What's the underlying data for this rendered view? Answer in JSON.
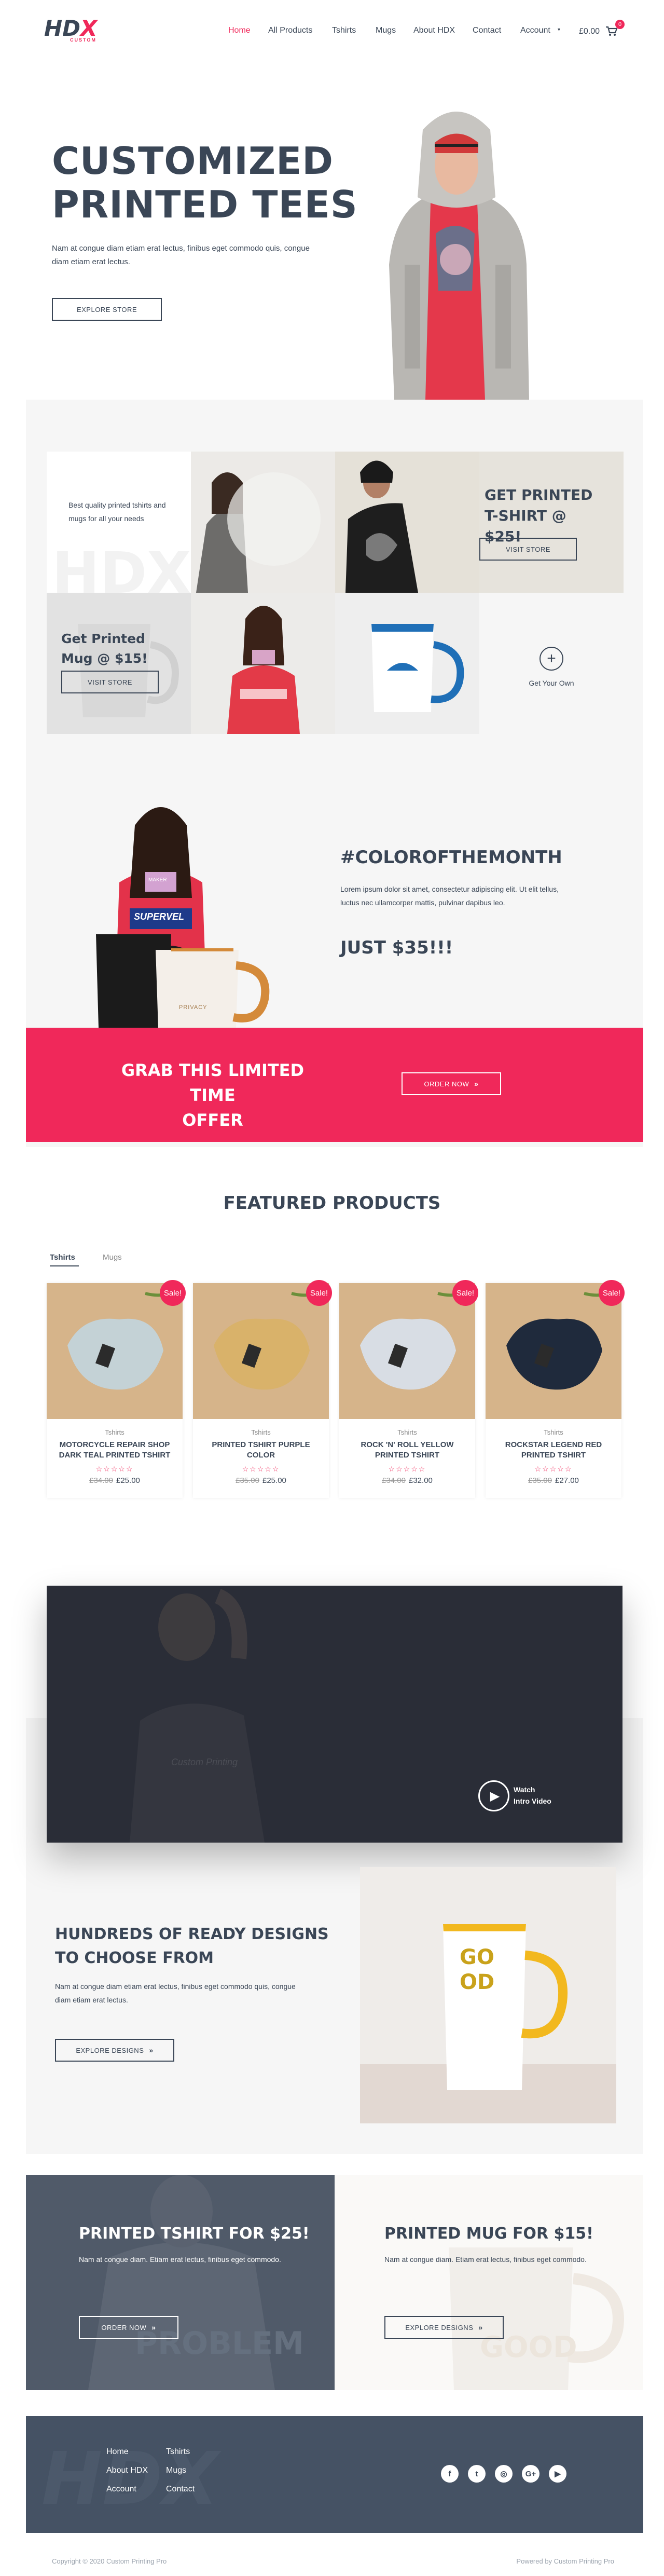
{
  "header": {
    "logo_text": "HDX",
    "logo_sub": "CUSTOM",
    "nav": [
      "Home",
      "All Products",
      "Tshirts",
      "Mugs",
      "About HDX",
      "Contact",
      "Account"
    ],
    "cart_total": "£0.00",
    "cart_count": "0"
  },
  "hero": {
    "title_line1": "CUSTOMIZED",
    "title_line2": "PRINTED TEES",
    "text": "Nam at congue diam etiam erat lectus, finibus eget commodo quis, congue diam etiam erat lectus.",
    "button": "EXPLORE STORE"
  },
  "tiles": {
    "intro_text": "Best quality printed tshirts and mugs for all your needs",
    "tshirt_title": "GET PRINTED T-SHIRT @ $25!",
    "tshirt_button": "VISIT STORE",
    "mug_title": "Get Printed Mug @ $15!",
    "mug_button": "VISIT STORE",
    "own_label": "Get Your Own",
    "watermark": "HDX"
  },
  "color_month": {
    "title": "#COLOROFTHEMONTH",
    "text": "Lorem ipsum dolor sit amet, consectetur adipiscing elit. Ut elit tellus, luctus nec ullamcorper mattis, pulvinar dapibus leo.",
    "price": "JUST $35!!!",
    "tee_print": "SUPERVEL",
    "card_text": "MAKER",
    "mug_text": "PRIVACY"
  },
  "offer": {
    "title_line1": "GRAB THIS LIMITED TIME",
    "title_line2": "OFFER",
    "button": "ORDER NOW"
  },
  "featured": {
    "title": "FEATURED PRODUCTS",
    "tabs": [
      "Tshirts",
      "Mugs"
    ],
    "products": [
      {
        "cat": "Tshirts",
        "title": "MOTORCYCLE REPAIR SHOP DARK TEAL PRINTED TSHIRT",
        "old": "£34.00",
        "price": "£25.00",
        "sale": "Sale!",
        "color": "#c4d2d6"
      },
      {
        "cat": "Tshirts",
        "title": "PRINTED TSHIRT PURPLE COLOR",
        "old": "£35.00",
        "price": "£25.00",
        "sale": "Sale!",
        "color": "#d9b26a"
      },
      {
        "cat": "Tshirts",
        "title": "ROCK 'N' ROLL YELLOW PRINTED TSHIRT",
        "old": "£34.00",
        "price": "£32.00",
        "sale": "Sale!",
        "color": "#d8dde4"
      },
      {
        "cat": "Tshirts",
        "title": "ROCKSTAR LEGEND RED PRINTED TSHIRT",
        "old": "£35.00",
        "price": "£27.00",
        "sale": "Sale!",
        "color": "#1f2a3c"
      }
    ]
  },
  "video": {
    "label_line1": "Watch",
    "label_line2": "Intro Video",
    "shirt_text": "Custom Printing"
  },
  "designs": {
    "title_line1": "HUNDREDS OF READY DESIGNS",
    "title_line2": "TO CHOOSE FROM",
    "text": "Nam at congue diam etiam erat lectus, finibus eget commodo quis, congue diam etiam erat lectus.",
    "button": "EXPLORE DESIGNS",
    "mug_text": "GOOD"
  },
  "promo": {
    "tshirt_title": "PRINTED TSHIRT FOR $25!",
    "tshirt_text": "Nam at congue diam. Etiam erat lectus, finibus eget commodo.",
    "tshirt_button": "ORDER NOW",
    "tshirt_bg_text": "PROBLEM",
    "mug_title": "PRINTED MUG FOR $15!",
    "mug_text": "Nam at congue diam. Etiam erat lectus, finibus eget commodo.",
    "mug_button": "EXPLORE DESIGNS",
    "mug_bg_text": "GOOD"
  },
  "footer": {
    "watermark": "HDX",
    "links_col1": [
      "Home",
      "About HDX",
      "Account"
    ],
    "links_col2": [
      "Tshirts",
      "Mugs",
      "Contact"
    ],
    "social": [
      {
        "name": "facebook-icon",
        "glyph": "f"
      },
      {
        "name": "twitter-icon",
        "glyph": "t"
      },
      {
        "name": "instagram-icon",
        "glyph": "◎"
      },
      {
        "name": "google-plus-icon",
        "glyph": "G+"
      },
      {
        "name": "youtube-icon",
        "glyph": "▶"
      }
    ],
    "copyright": "Copyright © 2020 Custom Printing Pro",
    "powered": "Powered by Custom Printing Pro"
  },
  "colors": {
    "accent": "#f0285a",
    "dark": "#3a4656",
    "light_bg": "#f6f6f6",
    "footer_bg": "#455264"
  }
}
